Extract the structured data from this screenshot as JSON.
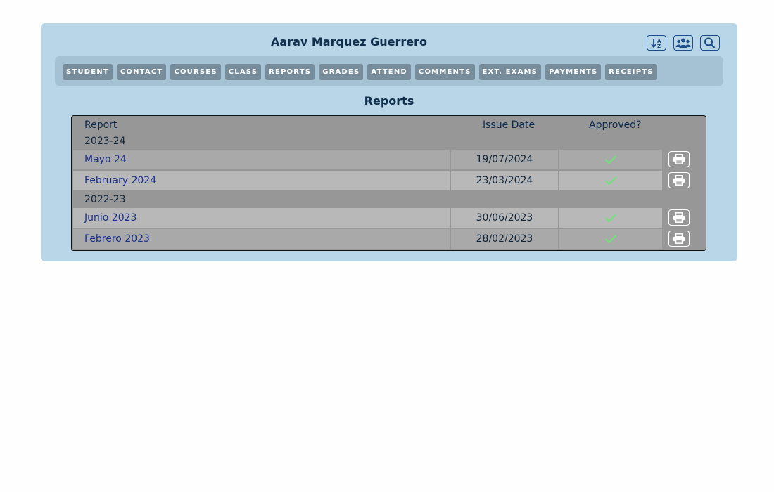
{
  "header": {
    "student_name": "Aarav Marquez Guerrero",
    "icons": [
      "sort-icon",
      "group-icon",
      "search-icon"
    ]
  },
  "nav": {
    "tabs": [
      {
        "label": "STUDENT"
      },
      {
        "label": "CONTACT"
      },
      {
        "label": "COURSES"
      },
      {
        "label": "CLASS"
      },
      {
        "label": "REPORTS"
      },
      {
        "label": "GRADES"
      },
      {
        "label": "ATTEND"
      },
      {
        "label": "COMMENTS"
      },
      {
        "label": "EXT. EXAMS"
      },
      {
        "label": "PAYMENTS"
      },
      {
        "label": "RECEIPTS"
      }
    ]
  },
  "section": {
    "title": "Reports"
  },
  "table": {
    "columns": {
      "report": "Report",
      "issue_date": "Issue Date",
      "approved": "Approved?"
    },
    "groups": [
      {
        "label": "2023-24",
        "rows": [
          {
            "report": "Mayo 24",
            "issue_date": "19/07/2024",
            "approved": true
          },
          {
            "report": "February 2024",
            "issue_date": "23/03/2024",
            "approved": true
          }
        ]
      },
      {
        "label": "2022-23",
        "rows": [
          {
            "report": "Junio 2023",
            "issue_date": "30/06/2023",
            "approved": true
          },
          {
            "report": "Febrero 2023",
            "issue_date": "28/02/2023",
            "approved": true
          }
        ]
      }
    ]
  },
  "colors": {
    "panel_bg": "#b8d6e8",
    "nav_bg": "#a5c2d4",
    "tab_bg": "#788d9b",
    "check": "#6fe37a",
    "link": "#1a2f8c"
  }
}
